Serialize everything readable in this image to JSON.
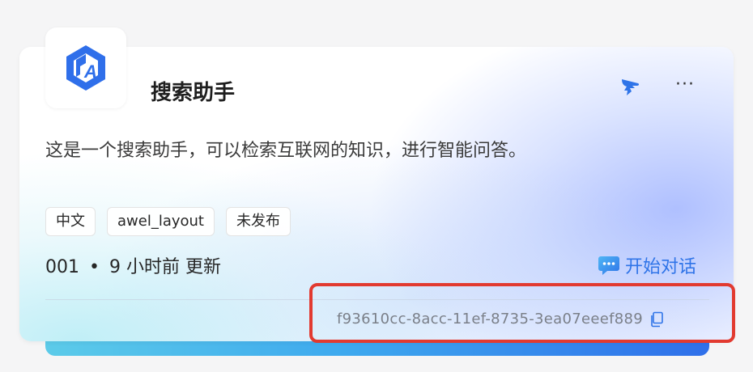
{
  "card": {
    "title": "搜索助手",
    "description": "这是一个搜索助手，可以检索互联网的知识，进行智能问答。",
    "tags": [
      {
        "label": "中文"
      },
      {
        "label": "awel_layout"
      },
      {
        "label": "未发布"
      }
    ],
    "meta": {
      "id": "001",
      "separator": "•",
      "updated": "9 小时前 更新"
    },
    "start_chat_label": "开始对话",
    "uuid": "f93610cc-8acc-11ef-8735-3ea07eeef889",
    "more_label": "···"
  },
  "icons": {
    "logo": "app-logo-icon",
    "dingtalk": "dingtalk-icon",
    "chat": "chat-bubble-icon",
    "copy": "copy-icon"
  },
  "colors": {
    "accent": "#2f74e8",
    "logo": "#2f6fea",
    "highlight": "#e23a30"
  }
}
